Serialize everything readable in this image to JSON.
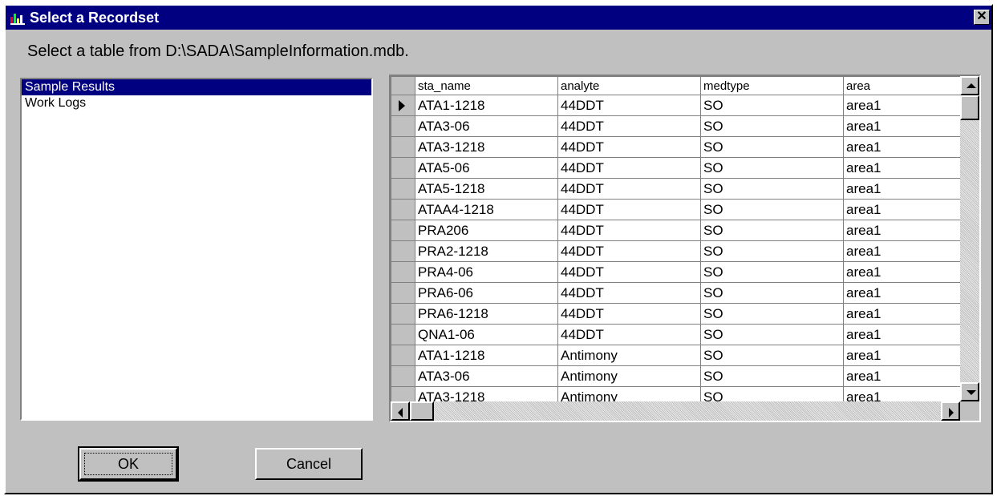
{
  "window": {
    "title": "Select a Recordset",
    "close_label": "✕"
  },
  "instruction": "Select a table from D:\\SADA\\SampleInformation.mdb.",
  "tables": [
    "Sample Results",
    "Work Logs"
  ],
  "selected_table": "Sample Results",
  "grid": {
    "columns": [
      "sta_name",
      "analyte",
      "medtype",
      "area"
    ],
    "rows": [
      [
        "ATA1-1218",
        "44DDT",
        "SO",
        "area1"
      ],
      [
        "ATA3-06",
        "44DDT",
        "SO",
        "area1"
      ],
      [
        "ATA3-1218",
        "44DDT",
        "SO",
        "area1"
      ],
      [
        "ATA5-06",
        "44DDT",
        "SO",
        "area1"
      ],
      [
        "ATA5-1218",
        "44DDT",
        "SO",
        "area1"
      ],
      [
        "ATAA4-1218",
        "44DDT",
        "SO",
        "area1"
      ],
      [
        "PRA206",
        "44DDT",
        "SO",
        "area1"
      ],
      [
        "PRA2-1218",
        "44DDT",
        "SO",
        "area1"
      ],
      [
        "PRA4-06",
        "44DDT",
        "SO",
        "area1"
      ],
      [
        "PRA6-06",
        "44DDT",
        "SO",
        "area1"
      ],
      [
        "PRA6-1218",
        "44DDT",
        "SO",
        "area1"
      ],
      [
        "QNA1-06",
        "44DDT",
        "SO",
        "area1"
      ],
      [
        "ATA1-1218",
        "Antimony",
        "SO",
        "area1"
      ],
      [
        "ATA3-06",
        "Antimony",
        "SO",
        "area1"
      ],
      [
        "ATA3-1218",
        "Antimony",
        "SO",
        "area1"
      ]
    ],
    "current_row": 0
  },
  "buttons": {
    "ok": "OK",
    "cancel": "Cancel"
  },
  "colors": {
    "titlebar": "#000080",
    "face": "#c0c0c0",
    "selection": "#000080"
  }
}
